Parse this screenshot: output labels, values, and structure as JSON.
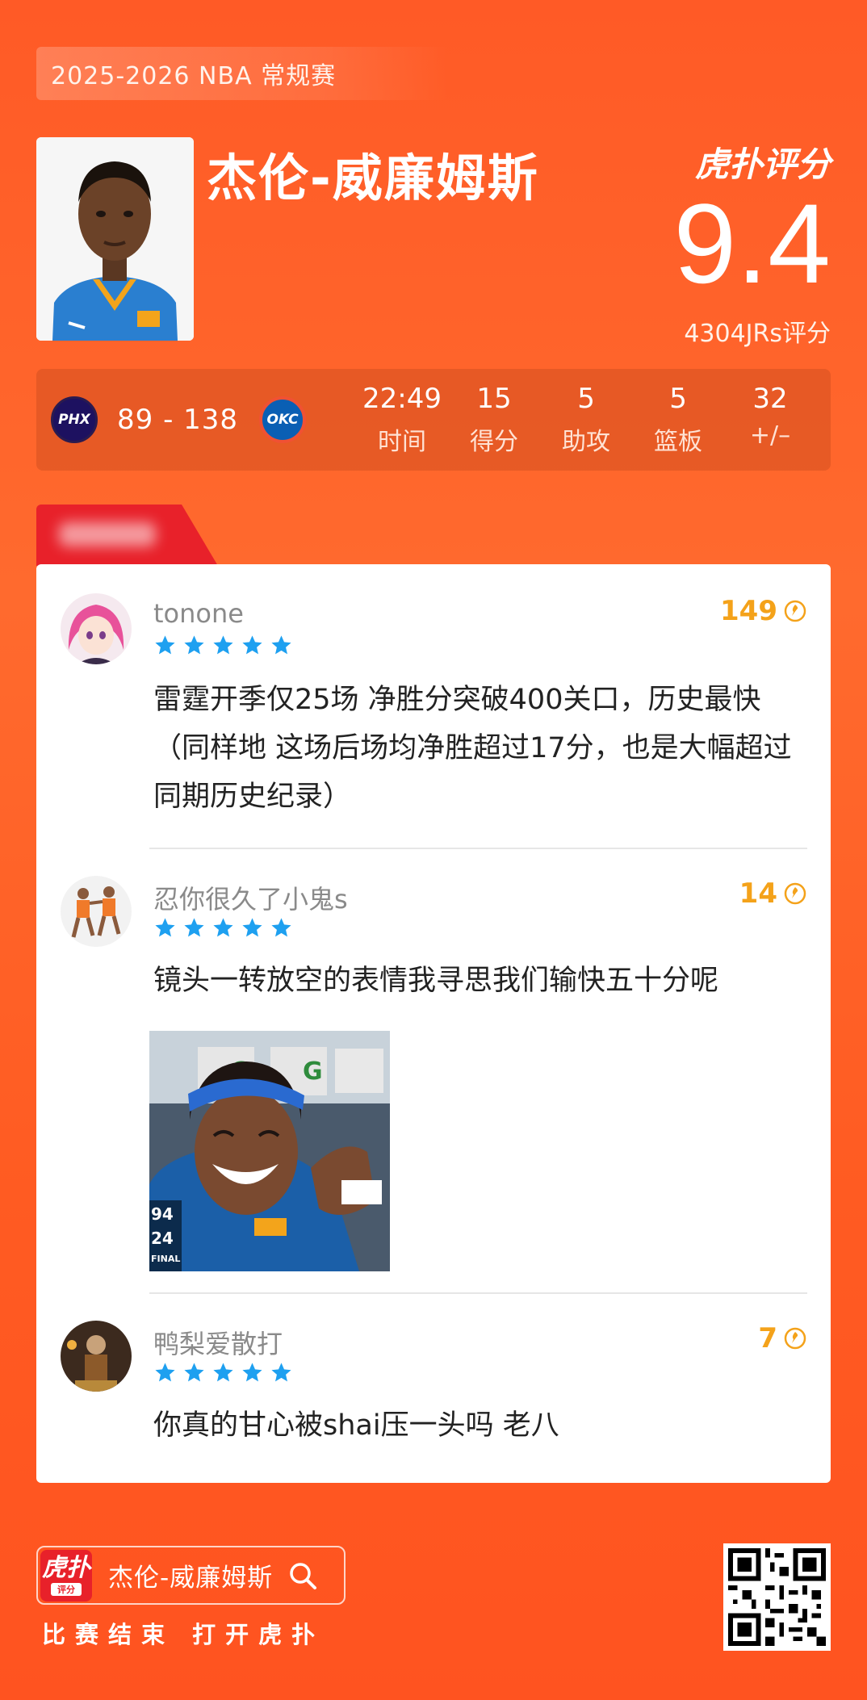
{
  "header": {
    "season": "2025-2026 NBA 常规赛",
    "player_name": "杰伦-威廉姆斯",
    "brand": "虎扑评分",
    "score": "9.4",
    "vote_count": "4304JRs评分"
  },
  "game": {
    "home_team": "PHX",
    "away_team": "OKC",
    "score": "89 - 138",
    "stats": [
      {
        "value": "22:49",
        "label": "时间"
      },
      {
        "value": "15",
        "label": "得分"
      },
      {
        "value": "5",
        "label": "助攻"
      },
      {
        "value": "5",
        "label": "篮板"
      },
      {
        "value": "32",
        "label": "+/–"
      }
    ]
  },
  "comments": [
    {
      "username": "tonone",
      "likes": "149",
      "stars": 5,
      "text": "雷霆开季仅25场 净胜分突破400关口，历史最快（同样地 这场后场均净胜超过17分，也是大幅超过同期历史纪录）"
    },
    {
      "username": "忍你很久了小鬼s",
      "likes": "14",
      "stars": 5,
      "text": "镜头一转放空的表情我寻思我们输快五十分呢",
      "image_overlay": [
        "94",
        "24",
        "FINAL"
      ]
    },
    {
      "username": "鸭梨爱散打",
      "likes": "7",
      "stars": 5,
      "text": "你真的甘心被shai压一头吗 老八"
    }
  ],
  "footer": {
    "app_icon_text": "虎扑",
    "app_icon_sub": "评分",
    "search_text": "杰伦-威廉姆斯",
    "caption": "比赛结束 打开虎扑"
  },
  "colors": {
    "background": "#ff5a26",
    "accent_red": "#e8212a",
    "star_blue": "#1ea0f0",
    "likes_gold": "#f4a21a"
  }
}
